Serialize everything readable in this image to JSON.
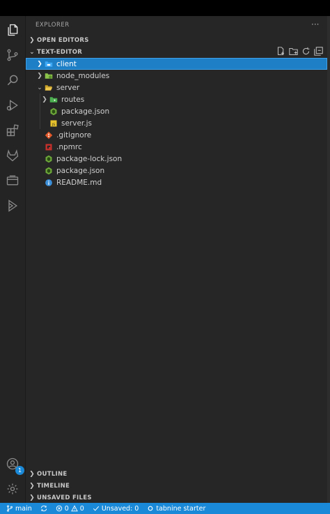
{
  "sidebar": {
    "title": "EXPLORER",
    "more": "···",
    "open_editors": "OPEN EDITORS",
    "workspace": "TEXT-EDITOR"
  },
  "tree": [
    {
      "label": "client",
      "type": "folder",
      "icon": "folder-client-icon",
      "depth": 0,
      "expanded": false,
      "selected": true
    },
    {
      "label": "node_modules",
      "type": "folder",
      "icon": "folder-node-icon",
      "depth": 0,
      "expanded": false
    },
    {
      "label": "server",
      "type": "folder",
      "icon": "folder-open-icon",
      "depth": 0,
      "expanded": true
    },
    {
      "label": "routes",
      "type": "folder",
      "icon": "folder-routes-icon",
      "depth": 1,
      "expanded": false
    },
    {
      "label": "package.json",
      "type": "file",
      "icon": "nodejs-icon",
      "depth": 1
    },
    {
      "label": "server.js",
      "type": "file",
      "icon": "js-icon",
      "depth": 1
    },
    {
      "label": ".gitignore",
      "type": "file",
      "icon": "git-icon",
      "depth": 0
    },
    {
      "label": ".npmrc",
      "type": "file",
      "icon": "npm-icon",
      "depth": 0
    },
    {
      "label": "package-lock.json",
      "type": "file",
      "icon": "nodejs-icon",
      "depth": 0
    },
    {
      "label": "package.json",
      "type": "file",
      "icon": "nodejs-icon",
      "depth": 0
    },
    {
      "label": "README.md",
      "type": "file",
      "icon": "info-icon",
      "depth": 0
    }
  ],
  "bottom_sections": [
    "OUTLINE",
    "TIMELINE",
    "UNSAVED FILES"
  ],
  "accounts_badge": "1",
  "status": {
    "branch": "main",
    "errors": "0",
    "warnings": "0",
    "unsaved": "Unsaved: 0",
    "tabnine": "tabnine starter"
  },
  "colors": {
    "accent": "#1a8ad8",
    "selected": "#1f7fc6"
  }
}
